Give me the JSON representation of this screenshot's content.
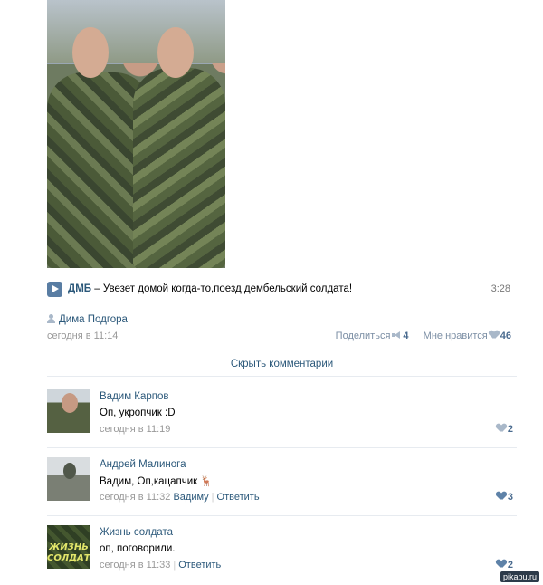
{
  "audio": {
    "artist": "ДМБ",
    "dash": " – ",
    "title": "Увезет домой когда-то,поезд дембельский солдата!",
    "duration": "3:28"
  },
  "post": {
    "author": "Дима Подгора",
    "time": "сегодня в 11:14",
    "share_label": "Поделиться",
    "share_count": "4",
    "like_label": "Мне нравится",
    "like_count": "46",
    "hide_comments": "Скрыть комментарии"
  },
  "comments": [
    {
      "name": "Вадим Карпов",
      "text": "Оп, укропчик :D",
      "time": "сегодня в 11:19",
      "likes": "2"
    },
    {
      "name": "Андрей Малинога",
      "text": "Вадим, Оп,кацапчик",
      "time": "сегодня в 11:32",
      "reply_to": "Вадиму",
      "reply": "Ответить",
      "likes": "3"
    },
    {
      "name": "Жизнь солдата",
      "text": "оп, поговорили.",
      "time": "сегодня в 11:33",
      "reply": "Ответить",
      "likes": "2",
      "avatar_line1": "ЖИЗНЬ",
      "avatar_line2": "СОЛДАТА"
    }
  ],
  "watermark": "pikabu.ru",
  "colors": {
    "link": "#2b587a",
    "muted": "#999999",
    "accent": "#597da3"
  },
  "icons": [
    "play-icon",
    "user-icon",
    "megaphone-icon",
    "heart-icon",
    "deer-icon"
  ]
}
